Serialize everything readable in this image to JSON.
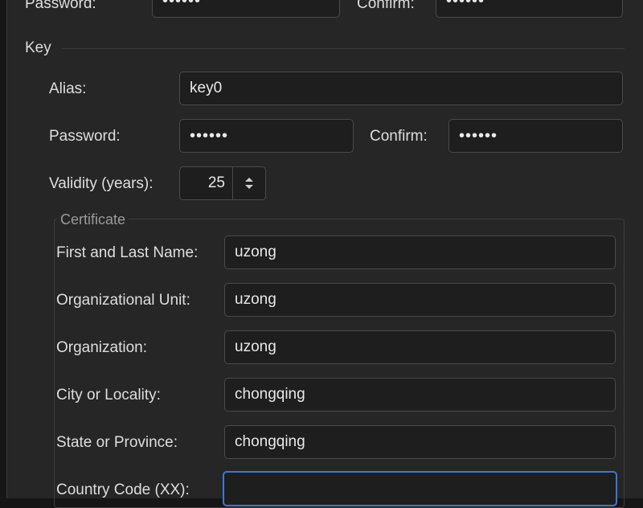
{
  "keystore": {
    "password_label": "Password:",
    "password_value": "••••••",
    "confirm_label": "Confirm:",
    "confirm_value": "••••••"
  },
  "key": {
    "section_title": "Key",
    "alias_label": "Alias:",
    "alias_value": "key0",
    "password_label": "Password:",
    "password_value": "••••••",
    "confirm_label": "Confirm:",
    "confirm_value": "••••••",
    "validity_label": "Validity (years):",
    "validity_value": "25"
  },
  "certificate": {
    "section_title": "Certificate",
    "first_last_name_label": "First and Last Name:",
    "first_last_name_value": "uzong",
    "org_unit_label": "Organizational Unit:",
    "org_unit_value": "uzong",
    "organization_label": "Organization:",
    "organization_value": "uzong",
    "city_label": "City or Locality:",
    "city_value": "chongqing",
    "state_label": "State or Province:",
    "state_value": "chongqing",
    "country_label": "Country Code (XX):",
    "country_value": ""
  },
  "colors": {
    "background": "#262626",
    "field": "#1e1e1e",
    "focus_ring": "#3b78d8"
  }
}
